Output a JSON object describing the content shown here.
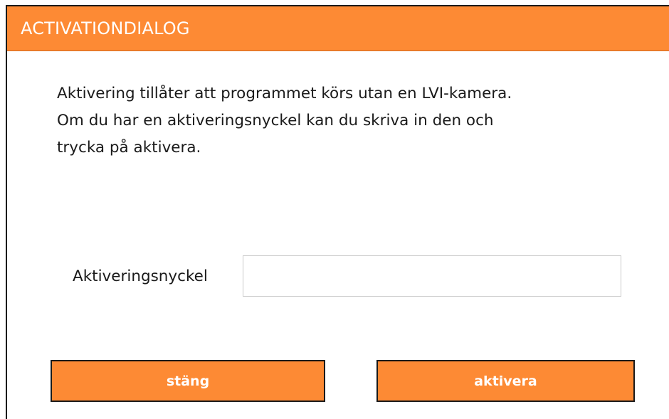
{
  "window": {
    "title": "ACTIVATIONDIALOG"
  },
  "message": {
    "lines": [
      "Aktivering tillåter att programmet körs utan en LVI-kamera.",
      "Om du har en aktiveringsnyckel kan du skriva in den och",
      "trycka på aktivera."
    ]
  },
  "activation_key": {
    "label": "Aktiveringsnyckel",
    "value": "",
    "placeholder": ""
  },
  "buttons": {
    "close_label": "stäng",
    "activate_label": "aktivera"
  },
  "colors": {
    "accent": "#fd8a34",
    "title_text": "#ffffff",
    "body_text": "#1a1a1a",
    "border": "#1a1a1a",
    "input_border": "#c9c9c9"
  }
}
